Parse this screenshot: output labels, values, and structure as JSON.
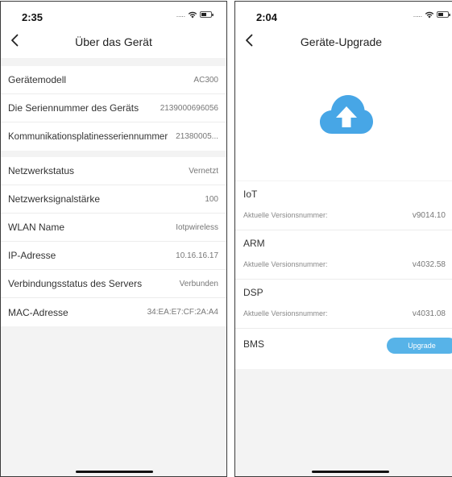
{
  "colors": {
    "accent": "#57b3e8",
    "background": "#f3f3f3",
    "cloud": "#47a6e6"
  },
  "left_screen": {
    "status": {
      "time": "2:35",
      "dots": "....."
    },
    "nav": {
      "title": "Über das Gerät"
    },
    "device_info": [
      {
        "label": "Gerätemodell",
        "value": "AC300"
      },
      {
        "label": "Die Seriennummer des Geräts",
        "value": "2139000696056"
      },
      {
        "label": "Kommunikationsplatinesseriennummer",
        "value": "21380005..."
      }
    ],
    "network_info": [
      {
        "label": "Netzwerkstatus",
        "value": "Vernetzt"
      },
      {
        "label": "Netzwerksignalstärke",
        "value": "100"
      },
      {
        "label": "WLAN Name",
        "value": "Iotpwireless"
      },
      {
        "label": "IP-Adresse",
        "value": "10.16.16.17"
      },
      {
        "label": "Verbindungsstatus des Servers",
        "value": "Verbunden"
      },
      {
        "label": "MAC-Adresse",
        "value": "34:EA:E7:CF:2A:A4"
      }
    ]
  },
  "right_screen": {
    "status": {
      "time": "2:04",
      "dots": "....."
    },
    "nav": {
      "title": "Geräte-Upgrade"
    },
    "hero_icon": "cloud-upload-icon",
    "versions": [
      {
        "name": "IoT",
        "key": "Aktuelle Versionsnummer:",
        "value": "v9014.10"
      },
      {
        "name": "ARM",
        "key": "Aktuelle Versionsnummer:",
        "value": "v4032.58"
      },
      {
        "name": "DSP",
        "key": "Aktuelle Versionsnummer:",
        "value": "v4031.08"
      }
    ],
    "bms": {
      "name": "BMS",
      "button_label": "Upgrade"
    }
  }
}
